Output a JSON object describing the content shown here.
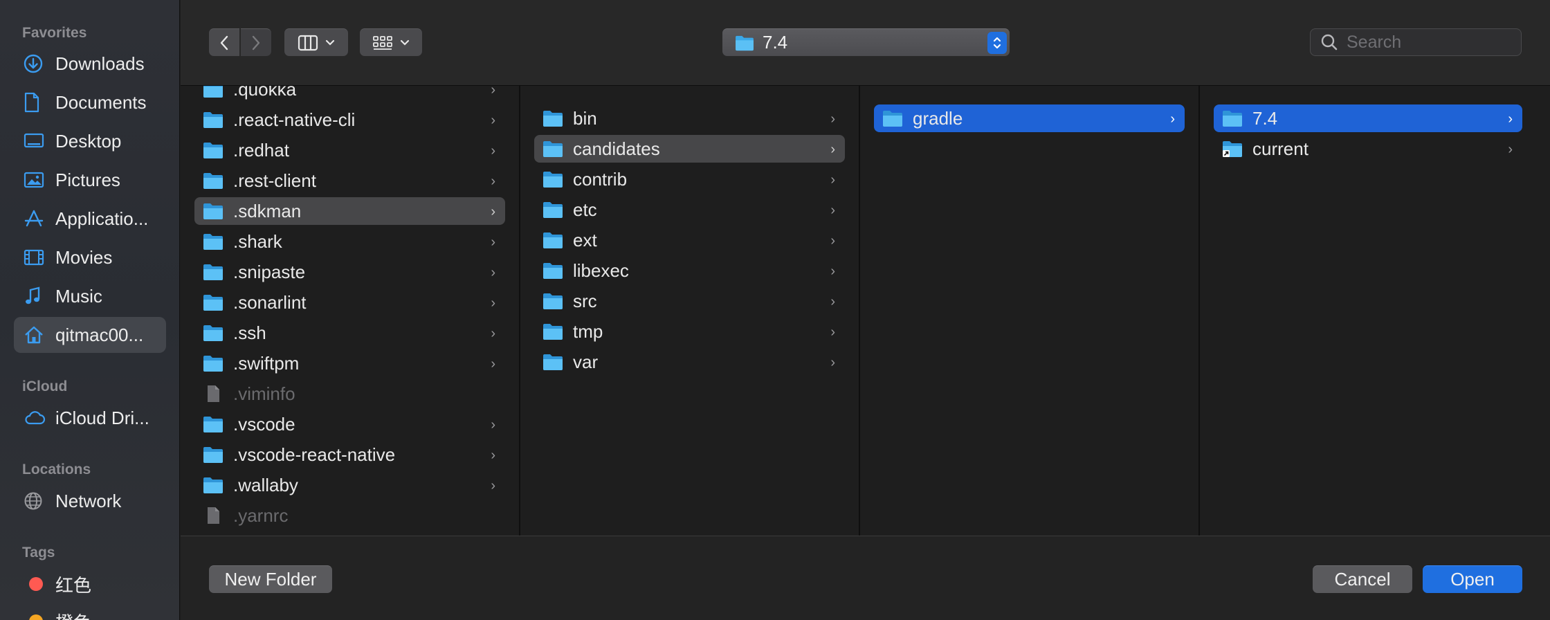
{
  "sidebar": {
    "favorites_header": "Favorites",
    "favorites": [
      {
        "label": "Downloads",
        "icon": "download-icon"
      },
      {
        "label": "Documents",
        "icon": "document-icon"
      },
      {
        "label": "Desktop",
        "icon": "desktop-icon"
      },
      {
        "label": "Pictures",
        "icon": "pictures-icon"
      },
      {
        "label": "Applicatio...",
        "icon": "applications-icon"
      },
      {
        "label": "Movies",
        "icon": "movies-icon"
      },
      {
        "label": "Music",
        "icon": "music-icon"
      },
      {
        "label": "qitmac00...",
        "icon": "home-icon",
        "selected": true
      }
    ],
    "icloud_header": "iCloud",
    "icloud_drive": "iCloud Dri...",
    "locations_header": "Locations",
    "network": "Network",
    "tags_header": "Tags",
    "tags": [
      {
        "label": "红色",
        "color": "#ff5a52"
      },
      {
        "label": "橙色",
        "color": "#f5a623"
      }
    ]
  },
  "toolbar": {
    "path_label": "7.4",
    "search_placeholder": "Search"
  },
  "colors": {
    "accent": "#1f6fe0",
    "folder": "#3aa8e8",
    "selection_blue": "#1f63d6",
    "selection_gray": "#474749"
  },
  "columns": {
    "col1": [
      {
        "name": ".quokka",
        "type": "folder"
      },
      {
        "name": ".react-native-cli",
        "type": "folder"
      },
      {
        "name": ".redhat",
        "type": "folder"
      },
      {
        "name": ".rest-client",
        "type": "folder"
      },
      {
        "name": ".sdkman",
        "type": "folder",
        "selected": "gray"
      },
      {
        "name": ".shark",
        "type": "folder"
      },
      {
        "name": ".snipaste",
        "type": "folder"
      },
      {
        "name": ".sonarlint",
        "type": "folder"
      },
      {
        "name": ".ssh",
        "type": "folder"
      },
      {
        "name": ".swiftpm",
        "type": "folder"
      },
      {
        "name": ".viminfo",
        "type": "file"
      },
      {
        "name": ".vscode",
        "type": "folder"
      },
      {
        "name": ".vscode-react-native",
        "type": "folder"
      },
      {
        "name": ".wallaby",
        "type": "folder"
      },
      {
        "name": ".yarnrc",
        "type": "file"
      }
    ],
    "col2": [
      {
        "name": "bin",
        "type": "folder"
      },
      {
        "name": "candidates",
        "type": "folder",
        "selected": "gray"
      },
      {
        "name": "contrib",
        "type": "folder"
      },
      {
        "name": "etc",
        "type": "folder"
      },
      {
        "name": "ext",
        "type": "folder"
      },
      {
        "name": "libexec",
        "type": "folder"
      },
      {
        "name": "src",
        "type": "folder"
      },
      {
        "name": "tmp",
        "type": "folder"
      },
      {
        "name": "var",
        "type": "folder"
      }
    ],
    "col3": [
      {
        "name": "gradle",
        "type": "folder",
        "selected": "blue"
      }
    ],
    "col4": [
      {
        "name": "7.4",
        "type": "folder",
        "selected": "blue"
      },
      {
        "name": "current",
        "type": "alias"
      }
    ]
  },
  "bottom": {
    "new_folder": "New Folder",
    "cancel": "Cancel",
    "open": "Open"
  }
}
